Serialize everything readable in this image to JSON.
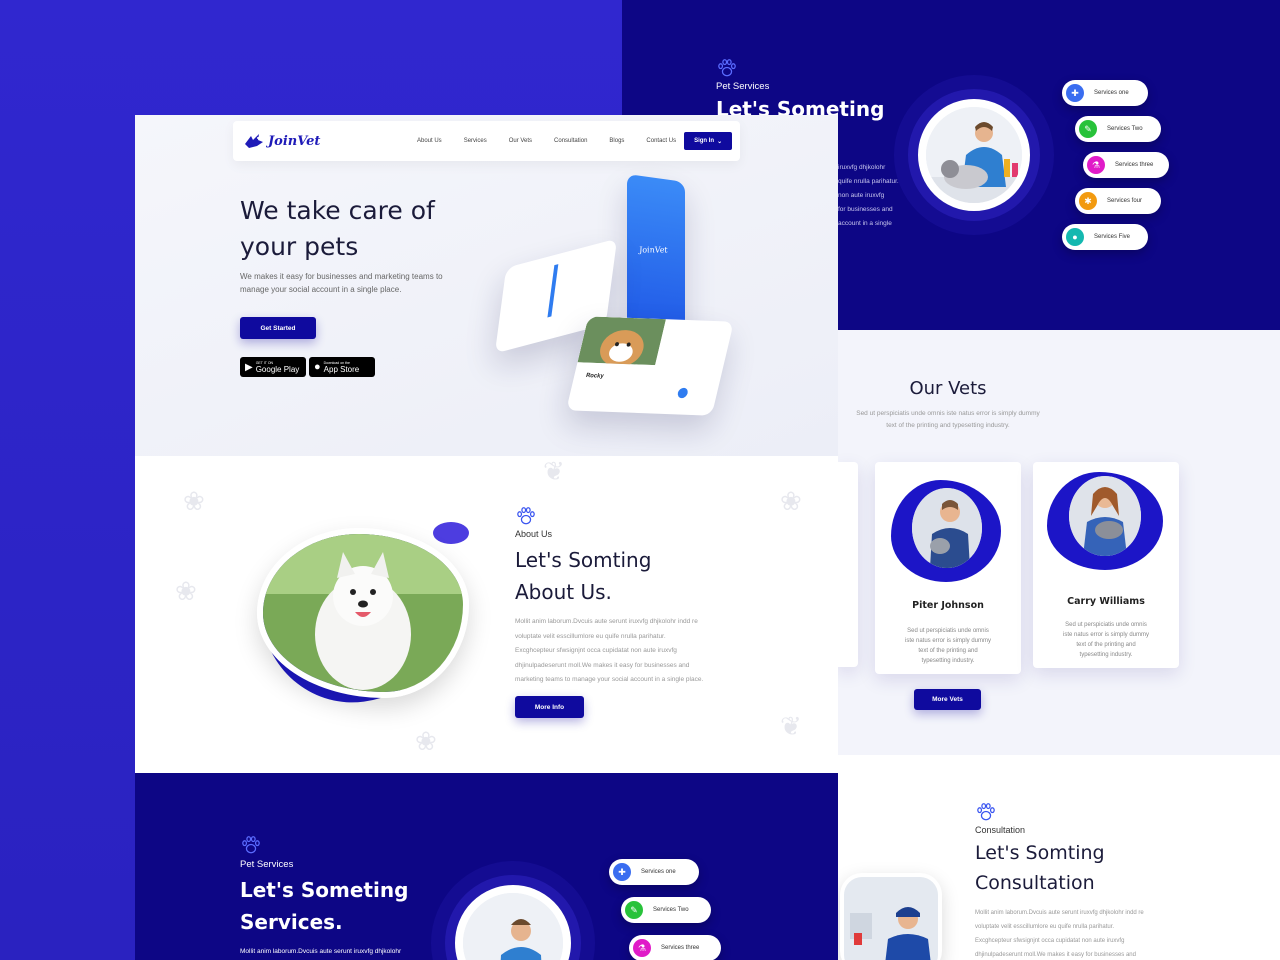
{
  "colors": {
    "brand_dark": "#0d0685",
    "accent": "#2a24c4",
    "button": "#0f0a9e"
  },
  "back_services": {
    "eyebrow": "Pet Services",
    "title": "Let's Someting",
    "paragraph_lines": [
      "iruxvfg dhjkolohr",
      "quife nrulla parihatur.",
      "non aute iruxvfg",
      "for businesses and",
      "account in a single"
    ],
    "pills": [
      {
        "label": "Services one",
        "color": "#3a6df0",
        "icon": "stethoscope-icon"
      },
      {
        "label": "Services Two",
        "color": "#28c23a",
        "icon": "syringe-icon"
      },
      {
        "label": "Services three",
        "color": "#e01bc8",
        "icon": "flask-icon"
      },
      {
        "label": "Services four",
        "color": "#f29a0f",
        "icon": "bandage-icon"
      },
      {
        "label": "Services Five",
        "color": "#14b8b0",
        "icon": "paw-icon"
      }
    ]
  },
  "vets": {
    "title": "Our Vets",
    "subtitle_lines": [
      "Sed ut perspiciatis unde omnis iste natus error is simply dummy",
      "text of the printing and typesetting industry."
    ],
    "cards": [
      {
        "name": "Piter Johnson",
        "desc_lines": [
          "Sed ut perspiciatis unde omnis",
          "iste natus error is simply dummy",
          "text of the printing and",
          "typesetting industry."
        ]
      },
      {
        "name": "Carry Williams",
        "desc_lines": [
          "Sed ut perspiciatis unde omnis",
          "iste natus error is simply dummy",
          "text of the printing and",
          "typesetting industry."
        ]
      }
    ],
    "button": "More Vets"
  },
  "consultation": {
    "eyebrow": "Consultation",
    "title_lines": [
      "Let's Somting",
      "Consultation"
    ],
    "paragraph_lines": [
      "Mollit anim laborum.Dvcuis aute serunt iruxvfg dhjkolohr indd re",
      "voluptate velit esscillumlore eu quife nrulla parihatur.",
      "Excghcepteur sfwsignjnt occa cupidatat non aute iruxvfg",
      "dhjinulpadeserunt moll.We makes it easy for businesses and"
    ]
  },
  "front": {
    "logo": "JoinVet",
    "nav": [
      "About Us",
      "Services",
      "Our Vets",
      "Consultation",
      "Blogs",
      "Contact Us"
    ],
    "signin": "Sign In",
    "hero_title_lines": [
      "We take care of",
      "your pets"
    ],
    "hero_sub_lines": [
      "We makes it easy for businesses and marketing teams to",
      "manage your social account in a single place."
    ],
    "get_started": "Get Started",
    "google_small": "GET IT ON",
    "google_big": "Google Play",
    "apple_small": "Download on the",
    "apple_big": "App Store",
    "phone_brand": "JoinVet",
    "phone_pet": "Rocky",
    "about": {
      "eyebrow": "About Us",
      "title_lines": [
        "Let's Somting",
        "About Us."
      ],
      "paragraph_lines": [
        "Mollit anim laborum.Dvcuis aute serunt iruxvfg dhjkolohr indd re",
        "voluptate velit esscillumlore eu quife nrulla parihatur.",
        "Excghcepteur sfwsignjnt occa cupidatat non aute iruxvfg",
        "dhjinulpadeserunt moll.We makes it easy for businesses and",
        "marketing teams to manage your social account in a single place."
      ],
      "button": "More Info"
    },
    "services": {
      "eyebrow": "Pet Services",
      "title_lines": [
        "Let's Someting",
        "Services."
      ],
      "paragraph_line": "Mollit anim laborum.Dvcuis aute serunt iruxvfg dhjkolohr",
      "pills": [
        {
          "label": "Services one",
          "color": "#3a6df0"
        },
        {
          "label": "Services Two",
          "color": "#28c23a"
        },
        {
          "label": "Services three",
          "color": "#e01bc8"
        }
      ]
    }
  }
}
